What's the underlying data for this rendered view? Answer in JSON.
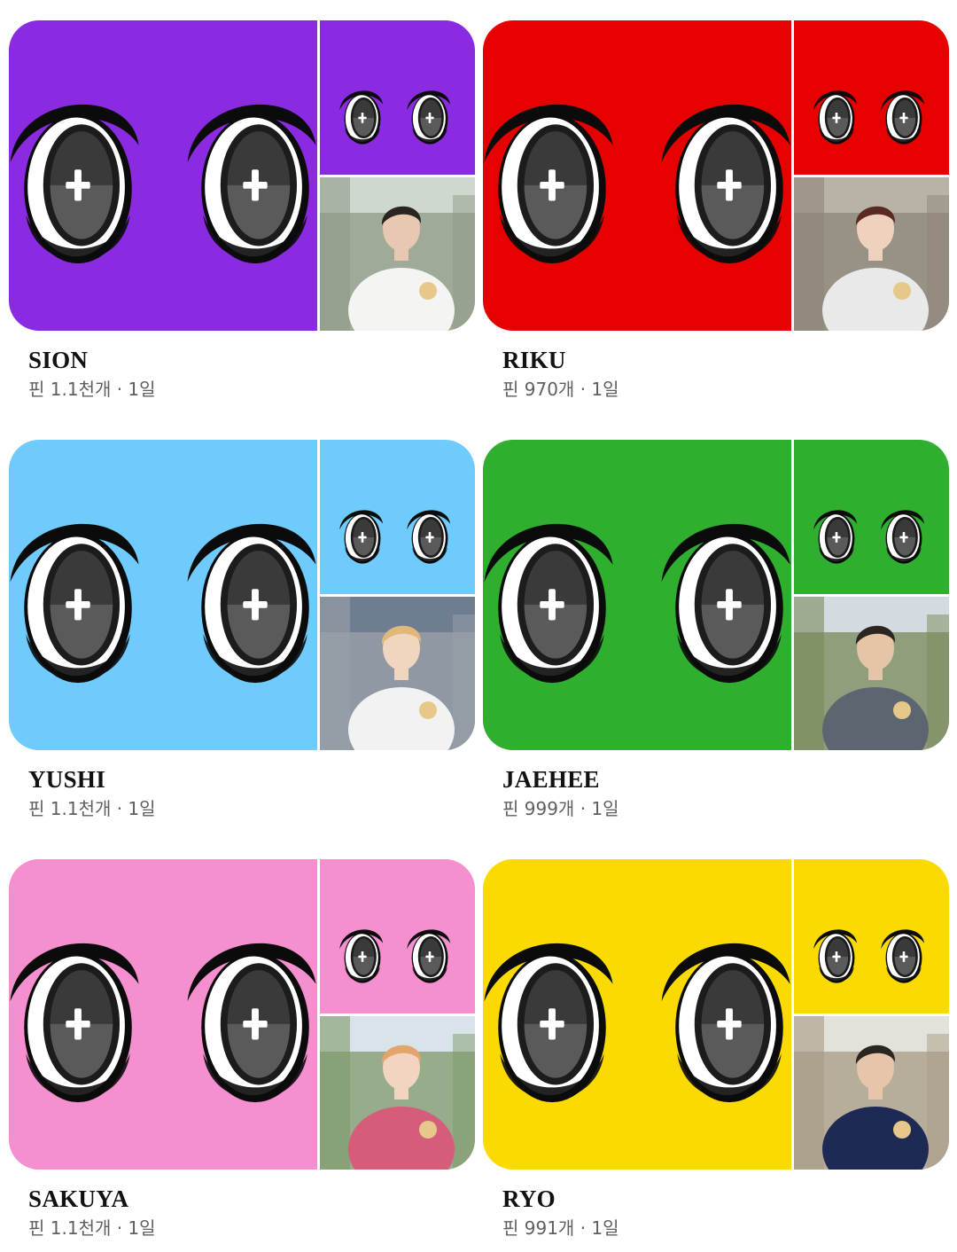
{
  "boards": [
    {
      "title": "SION",
      "meta": "핀 1.1천개 · 1일",
      "color": "#8a2be2",
      "photo": {
        "sky": "#cfd8cf",
        "bg": "#8f9b87",
        "shirt": "#f4f4f2",
        "hair": "#2a2520",
        "skin": "#e8c8b0"
      }
    },
    {
      "title": "RIKU",
      "meta": "핀 970개 · 1일",
      "color": "#e60000",
      "photo": {
        "sky": "#b9b2a6",
        "bg": "#8d857a",
        "shirt": "#e9e9ea",
        "hair": "#5a2a22",
        "skin": "#efd2bd"
      }
    },
    {
      "title": "YUSHI",
      "meta": "핀 1.1천개 · 1일",
      "color": "#6fcbfc",
      "photo": {
        "sky": "#6f7d92",
        "bg": "#9aa1a8",
        "shirt": "#f2f2f2",
        "hair": "#e0b87a",
        "skin": "#f0d5bf"
      }
    },
    {
      "title": "JAEHEE",
      "meta": "핀 999개 · 1일",
      "color": "#2fae2f",
      "photo": {
        "sky": "#d4dbe0",
        "bg": "#7a8a5a",
        "shirt": "#5c6670",
        "hair": "#2b2622",
        "skin": "#e5c4a8"
      }
    },
    {
      "title": "SAKUYA",
      "meta": "핀 1.1천개 · 1일",
      "color": "#f58fcf",
      "photo": {
        "sky": "#d9e4ea",
        "bg": "#7f9a6a",
        "shirt": "#d65d7a",
        "hair": "#e3a56b",
        "skin": "#f2d4c0"
      }
    },
    {
      "title": "RYO",
      "meta": "핀 991개 · 1일",
      "color": "#fada00",
      "photo": {
        "sky": "#e2e2da",
        "bg": "#a79b86",
        "shirt": "#1e2a55",
        "hair": "#2b2622",
        "skin": "#e6c5aa"
      }
    }
  ]
}
